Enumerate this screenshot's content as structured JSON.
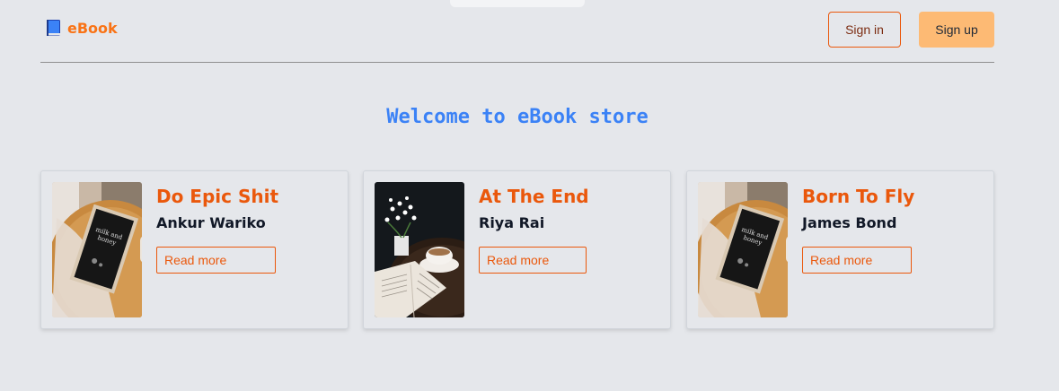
{
  "brand": {
    "icon": "book-icon",
    "text": "eBook"
  },
  "nav": {
    "sign_in": "Sign in",
    "sign_up": "Sign up"
  },
  "hero": {
    "title": "Welcome to eBook store"
  },
  "colors": {
    "accent": "#f97316",
    "title_blue": "#3b82f6",
    "signup_bg": "#fdba74",
    "page_bg": "#e5e7eb"
  },
  "books": [
    {
      "title": "Do Epic Shit",
      "author": "Ankur Wariko",
      "button": "Read more",
      "image": "book-on-wooden-table"
    },
    {
      "title": "At The End",
      "author": "Riya Rai",
      "button": "Read more",
      "image": "open-book-with-tea-and-flowers"
    },
    {
      "title": "Born To Fly",
      "author": "James Bond",
      "button": "Read more",
      "image": "book-on-wooden-table"
    }
  ]
}
